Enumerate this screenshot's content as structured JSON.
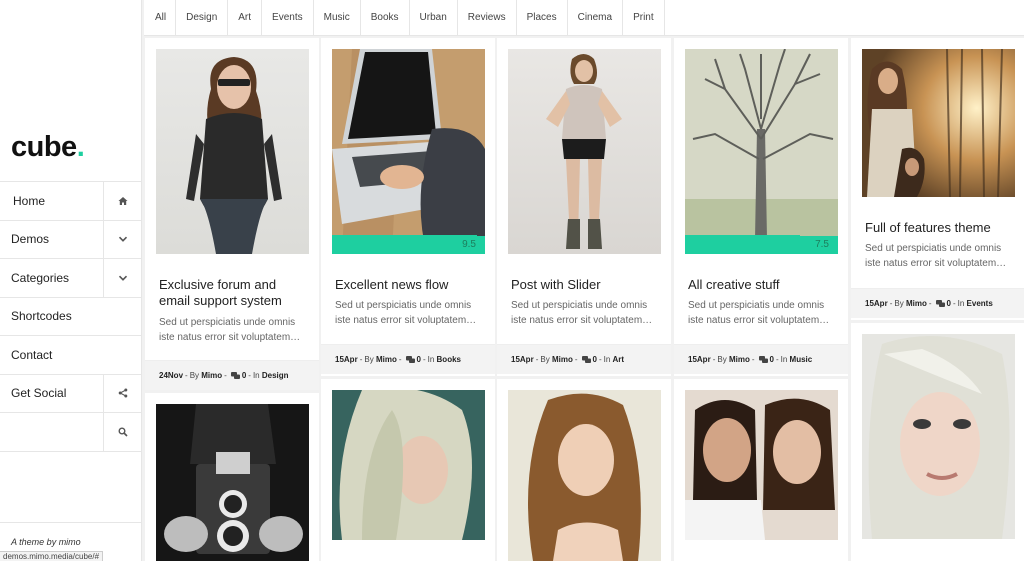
{
  "sidebar": {
    "logo_text": "cube",
    "logo_dot": ".",
    "nav": [
      {
        "label": "Home",
        "icon": "home-icon"
      },
      {
        "label": "Demos",
        "icon": "chevron-down-icon"
      },
      {
        "label": "Categories",
        "icon": "chevron-down-icon"
      },
      {
        "label": "Shortcodes",
        "icon": ""
      },
      {
        "label": "Contact",
        "icon": ""
      },
      {
        "label": "Get Social",
        "icon": "share-icon"
      },
      {
        "label": "",
        "icon": "search-icon"
      }
    ],
    "credit": "A theme by mimo",
    "status_url": "demos.mimo.media/cube/#"
  },
  "filters": [
    "All",
    "Design",
    "Art",
    "Events",
    "Music",
    "Books",
    "Urban",
    "Reviews",
    "Places",
    "Cinema",
    "Print"
  ],
  "cards": [
    {
      "title": "Exclusive forum and email support system",
      "excerpt": "Sed ut perspiciatis unde omnis iste natus error sit voluptatem…",
      "date": "24Nov",
      "by": "By",
      "author": "Mimo",
      "comments": "0",
      "in": "In",
      "category": "Design"
    },
    {
      "title": "Excellent news flow",
      "excerpt": "Sed ut perspiciatis unde omnis iste natus error sit voluptatem…",
      "date": "15Apr",
      "by": "By",
      "author": "Mimo",
      "comments": "0",
      "in": "In",
      "category": "Books",
      "score": "9.5",
      "score_fraction": 0.95
    },
    {
      "title": "Post with Slider",
      "excerpt": "Sed ut perspiciatis unde omnis iste natus error sit voluptatem…",
      "date": "15Apr",
      "by": "By",
      "author": "Mimo",
      "comments": "0",
      "in": "In",
      "category": "Art"
    },
    {
      "title": "All creative stuff",
      "excerpt": "Sed ut perspiciatis unde omnis iste natus error sit voluptatem…",
      "date": "15Apr",
      "by": "By",
      "author": "Mimo",
      "comments": "0",
      "in": "In",
      "category": "Music",
      "score": "7.5",
      "score_fraction": 0.75
    },
    {
      "title": "Full of features theme",
      "excerpt": "Sed ut perspiciatis unde omnis iste natus error sit voluptatem…",
      "date": "15Apr",
      "by": "By",
      "author": "Mimo",
      "comments": "0",
      "in": "In",
      "category": "Events"
    }
  ],
  "colors": {
    "accent": "#1ecfa0"
  }
}
